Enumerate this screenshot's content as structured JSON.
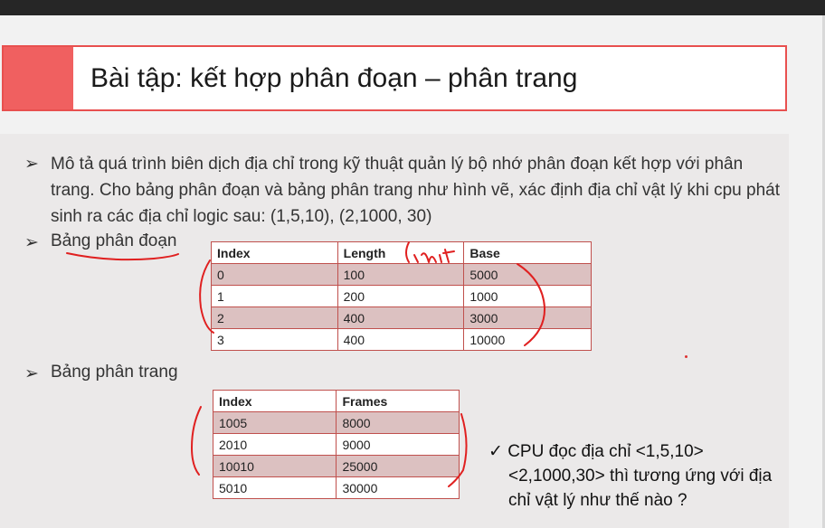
{
  "slide": {
    "title": "Bài tập: kết hợp phân đoạn – phân trang",
    "bullet_glyph": "➢",
    "check_glyph": "✓",
    "paragraph": "Mô tả quá trình biên dịch địa chỉ trong kỹ thuật quản lý bộ nhớ phân đoạn kết hợp với phân trang. Cho bảng phân đoạn và bảng phân trang như hình vẽ, xác định địa chỉ vật lý khi cpu phát sinh ra các địa chỉ logic sau: (1,5,10), (2,1000, 30)",
    "segment_label": "Bảng phân đoạn",
    "page_label": "Bảng phân trang",
    "cpu_line1": "CPU đọc địa chỉ <1,5,10>",
    "cpu_line2": "<2,1000,30> thì tương ứng với địa",
    "cpu_line3": "chỉ vật lý như thế nào ?",
    "annotation": "Limit"
  },
  "segment_table": {
    "headers": [
      "Index",
      "Length",
      "Base"
    ],
    "rows": [
      [
        "0",
        "100",
        "5000"
      ],
      [
        "1",
        "200",
        "1000"
      ],
      [
        "2",
        "400",
        "3000"
      ],
      [
        "3",
        "400",
        "10000"
      ]
    ]
  },
  "page_table": {
    "headers": [
      "Index",
      "Frames"
    ],
    "rows": [
      [
        "1005",
        "8000"
      ],
      [
        "2010",
        "9000"
      ],
      [
        "10010",
        "25000"
      ],
      [
        "5010",
        "30000"
      ]
    ]
  },
  "colors": {
    "accent": "#f06060",
    "table_border": "#c0504d",
    "row_shade": "#dcc1c1",
    "ink": "#e02020"
  }
}
